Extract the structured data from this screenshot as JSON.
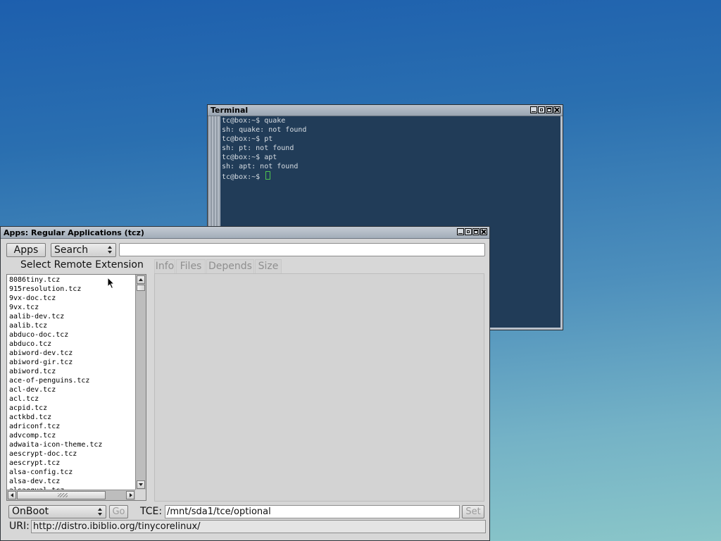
{
  "terminal": {
    "title": "Terminal",
    "lines": [
      "tc@box:~$ quake",
      "sh: quake: not found",
      "tc@box:~$ pt",
      "sh: pt: not found",
      "tc@box:~$ apt",
      "sh: apt: not found",
      "tc@box:~$ "
    ]
  },
  "apps": {
    "title": "Apps: Regular Applications (tcz)",
    "apps_button": "Apps",
    "search_select": "Search",
    "search_value": "",
    "list_header": "Select Remote Extension",
    "tabs": [
      "Info",
      "Files",
      "Depends",
      "Size"
    ],
    "extensions": [
      "8086tiny.tcz",
      "915resolution.tcz",
      "9vx-doc.tcz",
      "9vx.tcz",
      "aalib-dev.tcz",
      "aalib.tcz",
      "abduco-doc.tcz",
      "abduco.tcz",
      "abiword-dev.tcz",
      "abiword-gir.tcz",
      "abiword.tcz",
      "ace-of-penguins.tcz",
      "acl-dev.tcz",
      "acl.tcz",
      "acpid.tcz",
      "actkbd.tcz",
      "adriconf.tcz",
      "advcomp.tcz",
      "adwaita-icon-theme.tcz",
      "aescrypt-doc.tcz",
      "aescrypt.tcz",
      "alsa-config.tcz",
      "alsa-dev.tcz",
      "alsaequal.tcz"
    ],
    "onboot_select": "OnBoot",
    "go_button": "Go",
    "tce_label": "TCE:",
    "tce_path": "/mnt/sda1/tce/optional",
    "set_button": "Set",
    "uri_label": "URI:",
    "uri_value": "http://distro.ibiblio.org/tinycorelinux/"
  }
}
